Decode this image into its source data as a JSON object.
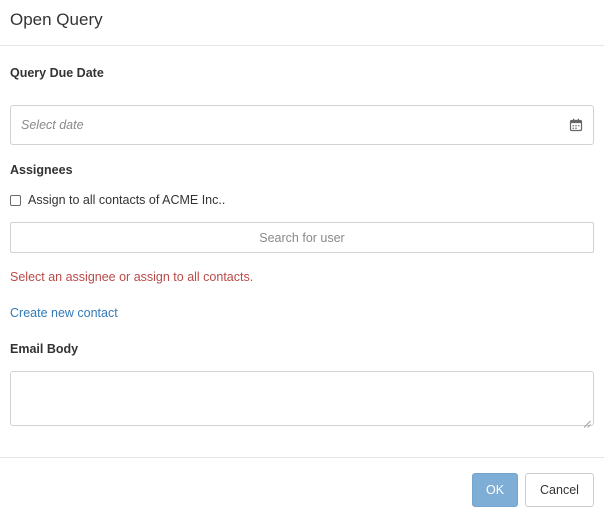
{
  "dialog": {
    "title": "Open Query"
  },
  "due_date": {
    "label": "Query Due Date",
    "placeholder": "Select date",
    "value": "",
    "icon": "calendar-icon"
  },
  "assignees": {
    "label": "Assignees",
    "assign_all_label": "Assign to all contacts of ACME Inc..",
    "assign_all_checked": false,
    "search_placeholder": "Search for user",
    "search_value": "",
    "error": "Select an assignee or assign to all contacts.",
    "create_contact_link": "Create new contact"
  },
  "email_body": {
    "label": "Email Body",
    "value": ""
  },
  "footer": {
    "ok_label": "OK",
    "cancel_label": "Cancel"
  },
  "colors": {
    "error": "#b94a48",
    "link": "#337ab7",
    "primary_button": "#7eaed6"
  }
}
